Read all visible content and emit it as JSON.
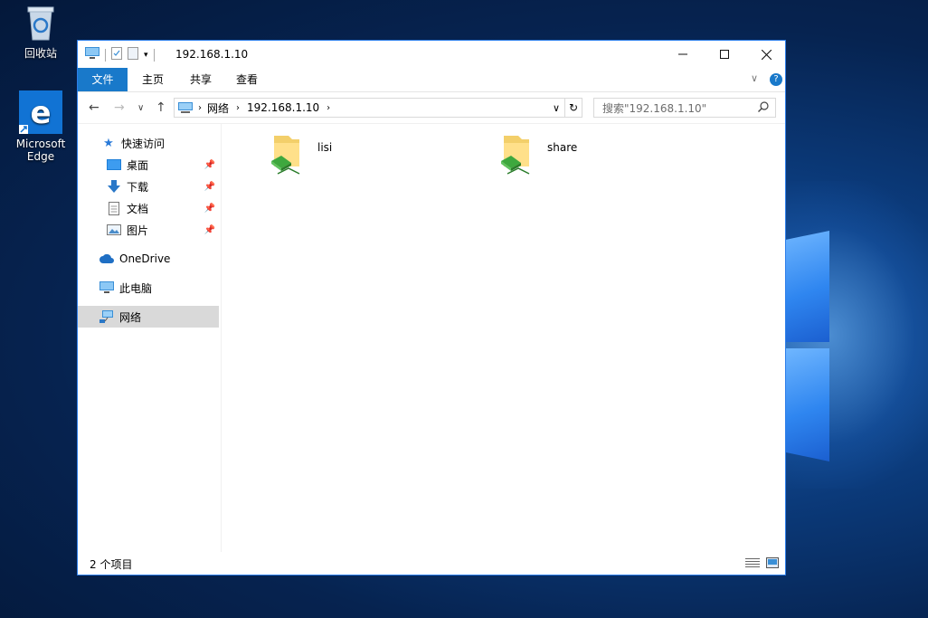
{
  "desktop": {
    "recycle_bin_label": "回收站",
    "edge_label_line1": "Microsoft",
    "edge_label_line2": "Edge"
  },
  "window": {
    "title": "192.168.1.10",
    "ribbon_tabs": [
      "文件",
      "主页",
      "共享",
      "查看"
    ],
    "address": {
      "segments": [
        "网络",
        "192.168.1.10"
      ]
    },
    "search_placeholder": "搜索\"192.168.1.10\"",
    "nav_pane": {
      "quick_access": "快速访问",
      "quick_items": [
        "桌面",
        "下载",
        "文档",
        "图片"
      ],
      "onedrive": "OneDrive",
      "this_pc": "此电脑",
      "network": "网络"
    },
    "folders": [
      "lisi",
      "share"
    ],
    "status": "2 个项目"
  },
  "colors": {
    "accent": "#1979ca",
    "border": "#2b7de9",
    "selected_nav": "#d9d9d9"
  }
}
